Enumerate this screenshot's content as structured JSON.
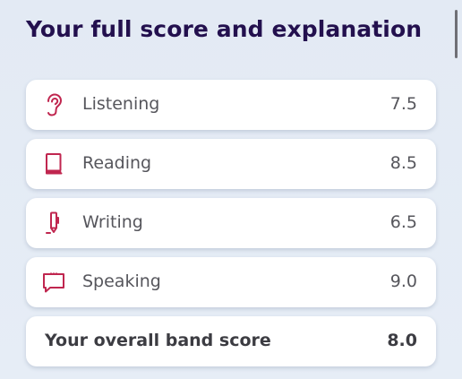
{
  "title": "Your full score and explanation",
  "colors": {
    "title": "#23104e",
    "icon_accent": "#c0264f",
    "background": "#e4ebf5",
    "card": "#ffffff"
  },
  "skills": [
    {
      "label": "Listening",
      "score": "7.5",
      "icon": "ear-icon"
    },
    {
      "label": "Reading",
      "score": "8.5",
      "icon": "book-icon"
    },
    {
      "label": "Writing",
      "score": "6.5",
      "icon": "pen-icon"
    },
    {
      "label": "Speaking",
      "score": "9.0",
      "icon": "speech-bubble-icon"
    }
  ],
  "overall": {
    "label": "Your overall band score",
    "score": "8.0"
  }
}
